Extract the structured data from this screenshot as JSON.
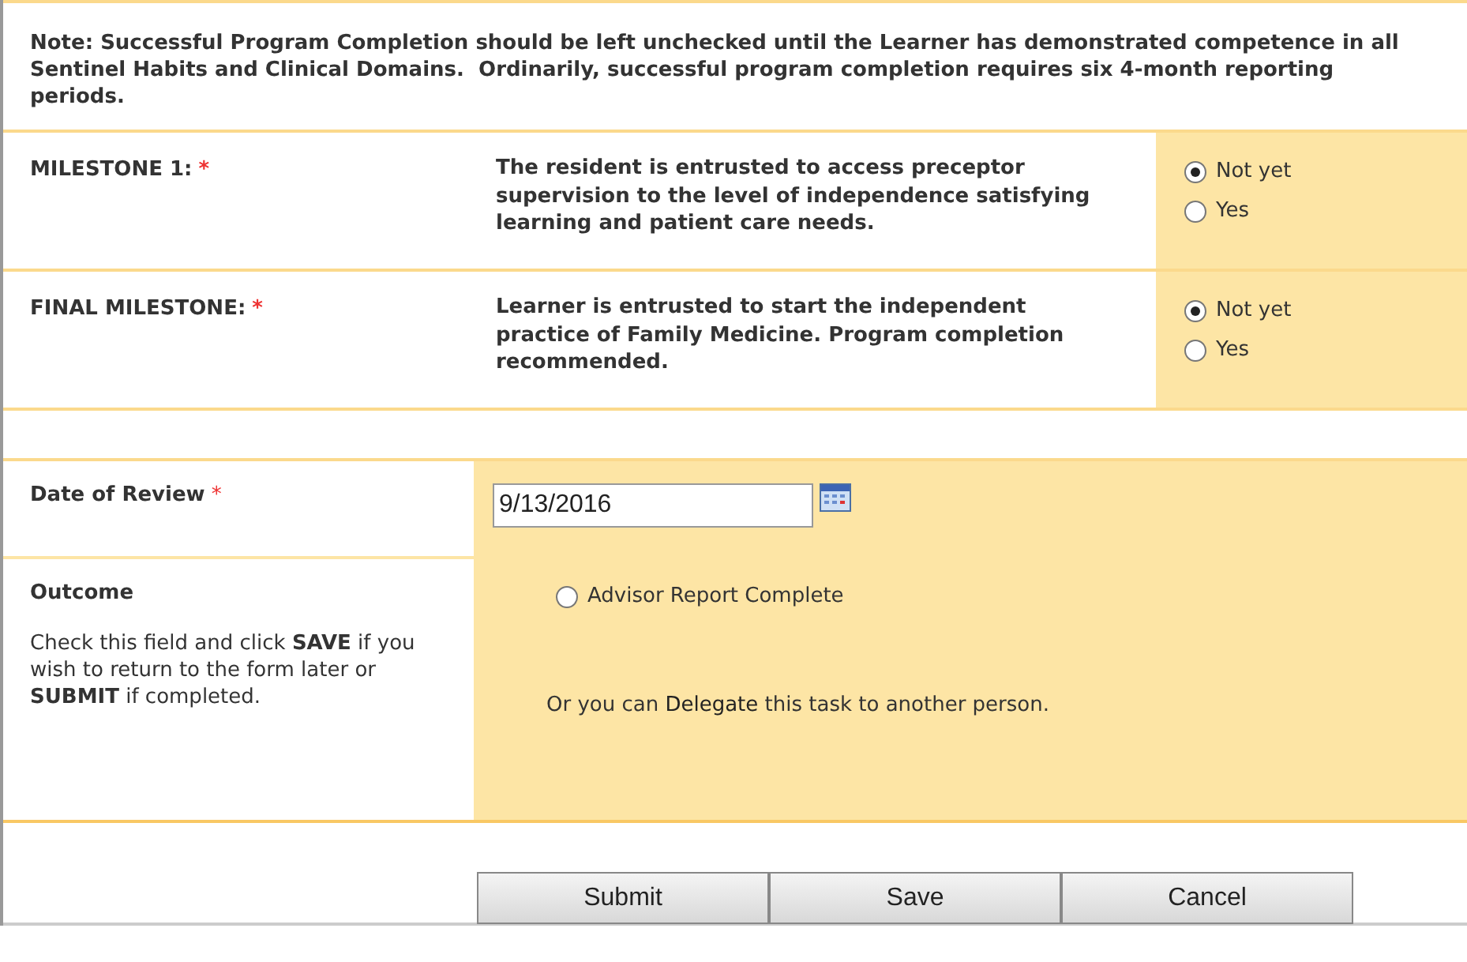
{
  "note": "Note: Successful Program Completion should be left unchecked until the Learner has demonstrated competence in all Sentinel Habits and Clinical Domains.  Ordinarily, successful program completion requires six 4-month reporting periods.",
  "milestones": [
    {
      "label": "MILESTONE 1:",
      "required_mark": "*",
      "description": "The resident is entrusted to access preceptor supervision to the level of independence satisfying learning and patient care needs.",
      "options": [
        {
          "label": "Not yet",
          "selected": true
        },
        {
          "label": "Yes",
          "selected": false
        }
      ]
    },
    {
      "label": "FINAL MILESTONE:",
      "required_mark": "*",
      "description": "Learner is entrusted to start the independent practice of Family Medicine. Program completion recommended.",
      "options": [
        {
          "label": "Not yet",
          "selected": true
        },
        {
          "label": "Yes",
          "selected": false
        }
      ]
    }
  ],
  "date_of_review": {
    "label": "Date of Review",
    "required_mark": "*",
    "value": "9/13/2016"
  },
  "outcome": {
    "label": "Outcome",
    "hint": "Check this field and click **SAVE** if you wish to return to the form later or **SUBMIT** if completed.",
    "option": {
      "label": "Advisor Report Complete",
      "selected": false
    },
    "delegate_prefix": "Or you can",
    "delegate_link": "Delegate",
    "delegate_suffix": "this task to another person."
  },
  "buttons": [
    "Submit",
    "Save",
    "Cancel"
  ]
}
